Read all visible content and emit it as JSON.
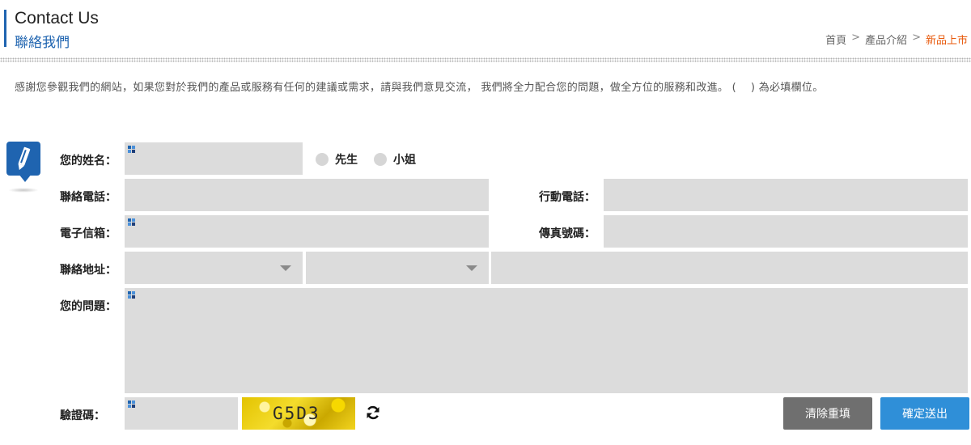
{
  "header": {
    "title_en": "Contact Us",
    "title_zh": "聯絡我們",
    "breadcrumb": [
      "首頁",
      "產品介紹",
      "新品上市"
    ],
    "breadcrumb_sep": ">"
  },
  "intro": {
    "text": "感謝您參觀我們的網站，如果您對於我們的產品或服務有任何的建議或需求，請與我們意見交流， 我們將全力配合您的問題，做全方位的服務和改進。 (",
    "suffix": ") 為必填欄位。"
  },
  "form": {
    "name_label": "您的姓名：",
    "gender_options": [
      "先生",
      "小姐"
    ],
    "phone_label": "聯絡電話：",
    "mobile_label": "行動電話：",
    "email_label": "電子信箱：",
    "fax_label": "傳真號碼：",
    "address_label": "聯絡地址：",
    "question_label": "您的問題：",
    "captcha_label": "驗證碼：",
    "captcha_text": "G5D3",
    "clear_button": "清除重填",
    "submit_button": "確定送出"
  },
  "colors": {
    "accent": "#1f64b0",
    "breadcrumb_current": "#e85a0c",
    "field_bg": "#dcdcdc",
    "clear_button": "#6f6f6f",
    "submit_button": "#2f8fd8"
  },
  "icons": [
    "pencil-icon",
    "required-mark-icon",
    "refresh-icon",
    "dropdown-caret-icon"
  ]
}
